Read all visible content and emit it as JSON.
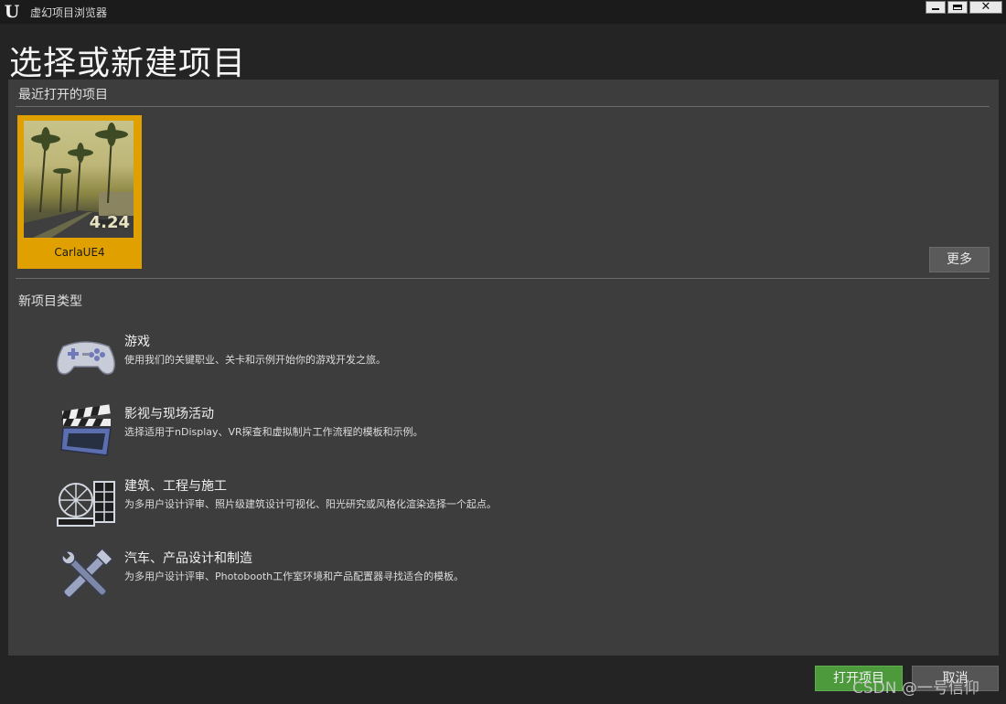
{
  "window": {
    "title": "虚幻项目浏览器",
    "logo_text": "U",
    "controls": {
      "close_glyph": "✕"
    }
  },
  "page": {
    "title": "选择或新建项目"
  },
  "recent": {
    "section_title": "最近打开的项目",
    "projects": [
      {
        "name": "CarlaUE4",
        "version": "4.24"
      }
    ],
    "more_label": "更多"
  },
  "templates": {
    "section_title": "新项目类型",
    "items": [
      {
        "name": "游戏",
        "description": "使用我们的关键职业、关卡和示例开始你的游戏开发之旅。",
        "icon": "gamepad-icon"
      },
      {
        "name": "影视与现场活动",
        "description": "选择适用于nDisplay、VR探查和虚拟制片工作流程的模板和示例。",
        "icon": "clapperboard-icon"
      },
      {
        "name": "建筑、工程与施工",
        "description": "为多用户设计评审、照片级建筑设计可视化、阳光研究或风格化渲染选择一个起点。",
        "icon": "architecture-icon"
      },
      {
        "name": "汽车、产品设计和制造",
        "description": "为多用户设计评审、Photobooth工作室环境和产品配置器寻找适合的模板。",
        "icon": "tools-icon"
      }
    ]
  },
  "footer": {
    "open_label": "打开项目",
    "cancel_label": "取消"
  },
  "watermark": "CSDN @一号信仰",
  "colors": {
    "accent_selected": "#e0a000",
    "primary_button": "#4c9a3c",
    "panel": "#3d3d3d",
    "background": "#242424"
  }
}
